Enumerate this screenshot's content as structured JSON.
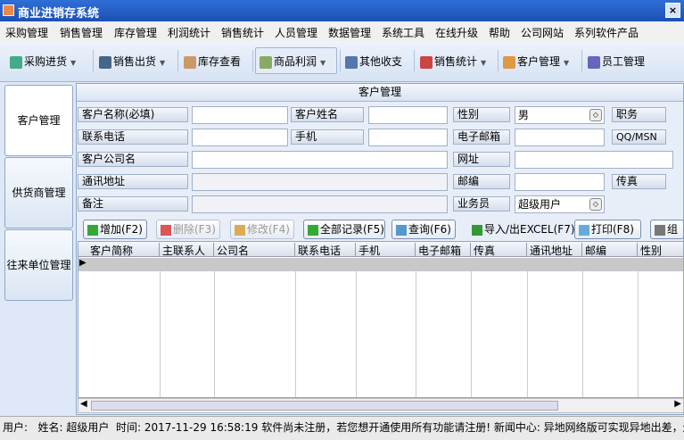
{
  "window": {
    "title": "商业进销存系统",
    "close": "×"
  },
  "menu": [
    "采购管理",
    "销售管理",
    "库存管理",
    "利润统计",
    "销售统计",
    "人员管理",
    "数据管理",
    "系统工具",
    "在线升级",
    "帮助",
    "公司网站",
    "系列软件产品"
  ],
  "toolbar": [
    "采购进货",
    "销售出货",
    "库存查看",
    "商品利润",
    "其他收支",
    "销售统计",
    "客户管理",
    "员工管理"
  ],
  "sidebar": [
    "客户管理",
    "供货商管理",
    "往来单位管理"
  ],
  "panel": {
    "title": "客户管理"
  },
  "form": {
    "name_label": "客户名称(必填)",
    "contact_name_label": "客户姓名",
    "gender_label": "性别",
    "gender_value": "男",
    "position_label": "职务",
    "phone_label": "联系电话",
    "mobile_label": "手机",
    "email_label": "电子邮箱",
    "qq_label": "QQ/MSN",
    "company_label": "客户公司名",
    "website_label": "网址",
    "address_label": "通讯地址",
    "zip_label": "邮编",
    "fax_label": "传真",
    "note_label": "备注",
    "salesperson_label": "业务员",
    "salesperson_value": "超级用户"
  },
  "actions": {
    "add": "增加(F2)",
    "delete": "删除(F3)",
    "edit": "修改(F4)",
    "all": "全部记录(F5)",
    "query": "查询(F6)",
    "import_export": "导入/出EXCEL(F7)",
    "print": "打印(F8)",
    "more": "组"
  },
  "grid": {
    "columns": [
      "客户简称",
      "主联系人",
      "公司名",
      "联系电话",
      "手机",
      "电子邮箱",
      "传真",
      "通讯地址",
      "邮编",
      "性别"
    ],
    "rows": []
  },
  "status": {
    "user_label": "用户:",
    "name_label": "姓名:",
    "name_value": "超级用户",
    "time_label": "时间:",
    "time_value": "2017-11-29 16:58:19",
    "message": "软件尚未注册，若您想开通使用所有功能请注册! 新闻中心: 异地网络版可实现异地出差，连锁"
  },
  "colors": {
    "titlebar": "#2f6fd6",
    "panel_bg": "#e8eef8",
    "selected_row": "#c8c8c8"
  }
}
